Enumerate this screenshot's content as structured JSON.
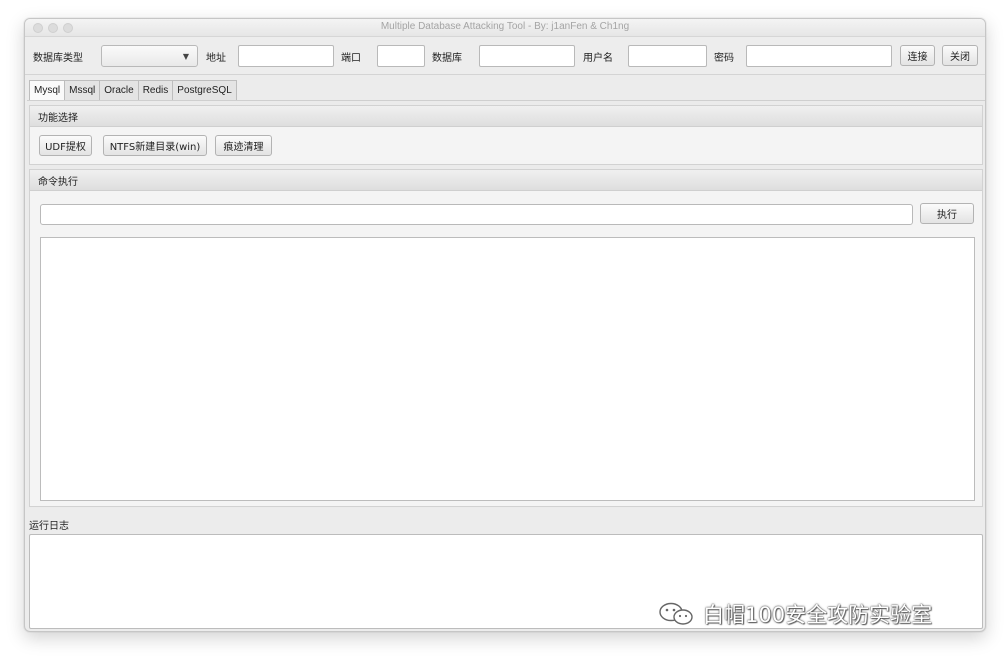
{
  "window": {
    "title": "Multiple Database Attacking Tool - By: j1anFen & Ch1ng"
  },
  "toolbar": {
    "db_type_label": "数据库类型",
    "db_type_value": "",
    "address_label": "地址",
    "address_value": "",
    "port_label": "端口",
    "port_value": "",
    "database_label": "数据库",
    "database_value": "",
    "username_label": "用户名",
    "username_value": "",
    "password_label": "密码",
    "password_value": "",
    "connect_label": "连接",
    "close_label": "关闭"
  },
  "tabs": [
    {
      "label": "Mysql",
      "active": true
    },
    {
      "label": "Mssql",
      "active": false
    },
    {
      "label": "Oracle",
      "active": false
    },
    {
      "label": "Redis",
      "active": false
    },
    {
      "label": "PostgreSQL",
      "active": false
    }
  ],
  "function_panel": {
    "title": "功能选择",
    "buttons": [
      "UDF提权",
      "NTFS新建目录(win)",
      "痕迹清理"
    ]
  },
  "command_panel": {
    "title": "命令执行",
    "input_value": "",
    "execute_label": "执行",
    "output": ""
  },
  "log": {
    "label": "运行日志",
    "content": ""
  },
  "watermark": {
    "text": "白帽100安全攻防实验室",
    "icon": "wechat-icon"
  }
}
